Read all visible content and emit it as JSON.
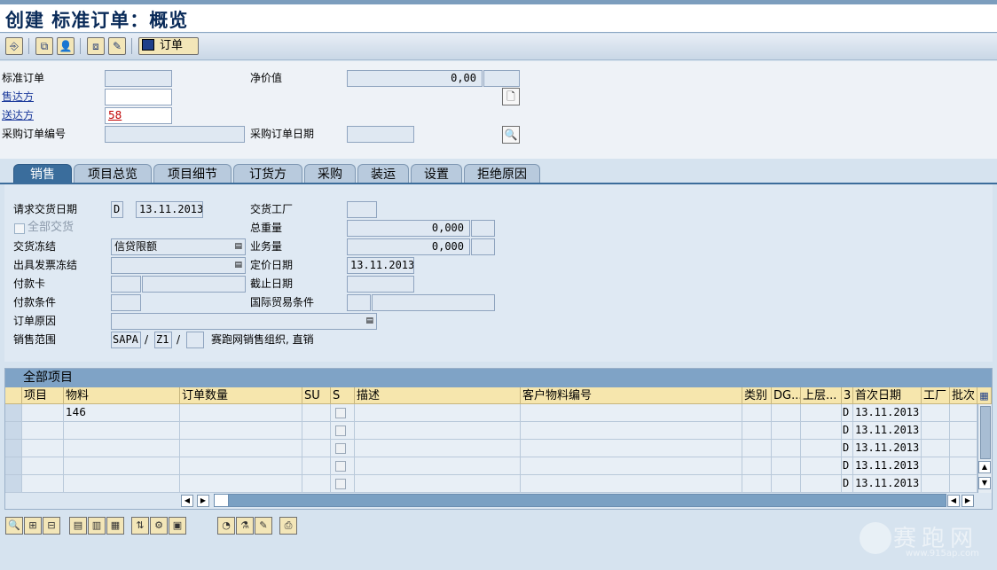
{
  "window": {
    "title": "创建 标准订单：概览"
  },
  "toolbar": {
    "order_button_label": "订单",
    "icons": [
      "display-document-icon",
      "copy-icon",
      "person-icon",
      "header-details-icon",
      "edit-pencil-icon",
      "order-table-icon"
    ]
  },
  "header": {
    "std_order_label": "标准订单",
    "std_order_value": "",
    "net_value_label": "净价值",
    "net_value": "0,00",
    "currency_value": "",
    "sold_to_label": "售达方",
    "sold_to_value": "",
    "ship_to_label": "送达方",
    "ship_to_value": "58",
    "po_number_label": "采购订单编号",
    "po_number_value": "",
    "po_date_label": "采购订单日期",
    "po_date_value": ""
  },
  "tabs": [
    {
      "label": "销售",
      "active": true
    },
    {
      "label": "项目总览"
    },
    {
      "label": "项目细节"
    },
    {
      "label": "订货方"
    },
    {
      "label": "采购"
    },
    {
      "label": "装运"
    },
    {
      "label": "设置"
    },
    {
      "label": "拒绝原因"
    }
  ],
  "sales": {
    "req_delivery_date_label": "请求交货日期",
    "req_delivery_date_type": "D",
    "req_delivery_date": "13.11.2013",
    "delivering_plant_label": "交货工厂",
    "delivering_plant": "",
    "complete_delivery_label": "全部交货",
    "total_weight_label": "总重量",
    "total_weight": "0,000",
    "delivery_block_label": "交货冻结",
    "delivery_block_value": "信贷限额",
    "volume_label": "业务量",
    "volume": "0,000",
    "billing_block_label": "出具发票冻结",
    "billing_block_value": "",
    "pricing_date_label": "定价日期",
    "pricing_date": "13.11.2013",
    "payment_card_label": "付款卡",
    "cutoff_date_label": "截止日期",
    "payment_terms_label": "付款条件",
    "incoterms_label": "国际贸易条件",
    "order_reason_label": "订单原因",
    "sales_area_label": "销售范围",
    "sales_org": "SAPA",
    "distribution_channel": "Z1",
    "division": "",
    "sep": "/",
    "sales_area_desc": "赛跑网销售组织, 直销"
  },
  "items_table": {
    "title": "全部项目",
    "columns": [
      "项目",
      "物料",
      "订单数量",
      "SU",
      "S",
      "描述",
      "客户物料编号",
      "类别",
      "DG...",
      "上层...",
      "3",
      "首次日期",
      "工厂",
      "批次"
    ],
    "rows": [
      {
        "material": "146",
        "date_type": "D",
        "first_date": "13.11.2013"
      },
      {
        "material": "",
        "date_type": "D",
        "first_date": "13.11.2013"
      },
      {
        "material": "",
        "date_type": "D",
        "first_date": "13.11.2013"
      },
      {
        "material": "",
        "date_type": "D",
        "first_date": "13.11.2013"
      },
      {
        "material": "",
        "date_type": "D",
        "first_date": "13.11.2013"
      }
    ]
  },
  "watermark": {
    "text": "赛跑网",
    "url": "www.915ap.com"
  }
}
